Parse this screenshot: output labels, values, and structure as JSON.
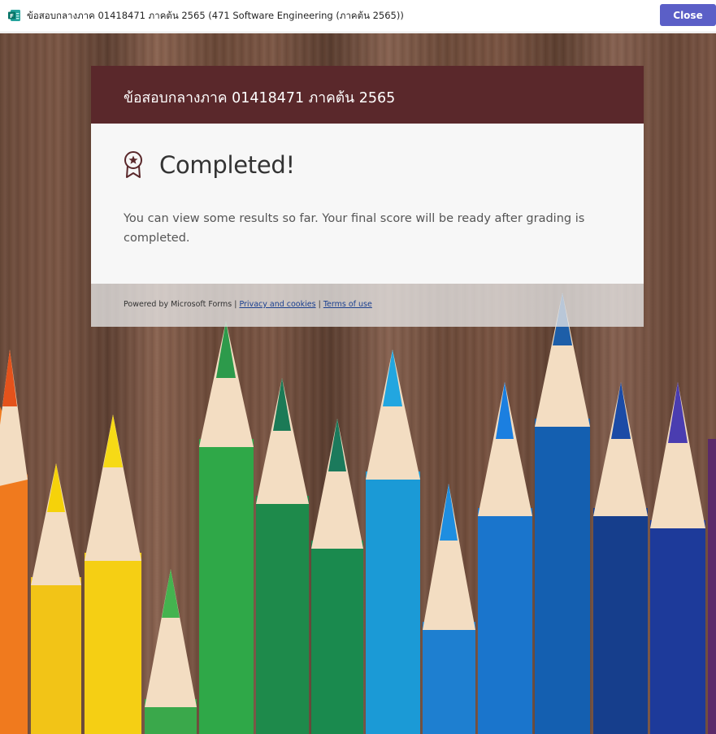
{
  "window": {
    "title": "ข้อสอบกลางภาค 01418471 ภาคต้น 2565 (471 Software Engineering (ภาคต้น 2565))",
    "close_label": "Close",
    "app_icon": "microsoft-forms-icon"
  },
  "form": {
    "header_title": "ข้อสอบกลางภาค 01418471 ภาคต้น 2565",
    "completed_heading": "Completed!",
    "completed_message": "You can view some results so far. Your final score will be ready after grading is completed.",
    "badge_icon": "award-ribbon-icon"
  },
  "footer": {
    "powered_by": "Powered by Microsoft Forms |",
    "privacy_link": "Privacy and cookies",
    "separator": "|",
    "terms_link": "Terms of use"
  },
  "colors": {
    "header_bg": "#5a282b",
    "close_button": "#5b5fc7",
    "card_bg": "#f7f7f7"
  }
}
